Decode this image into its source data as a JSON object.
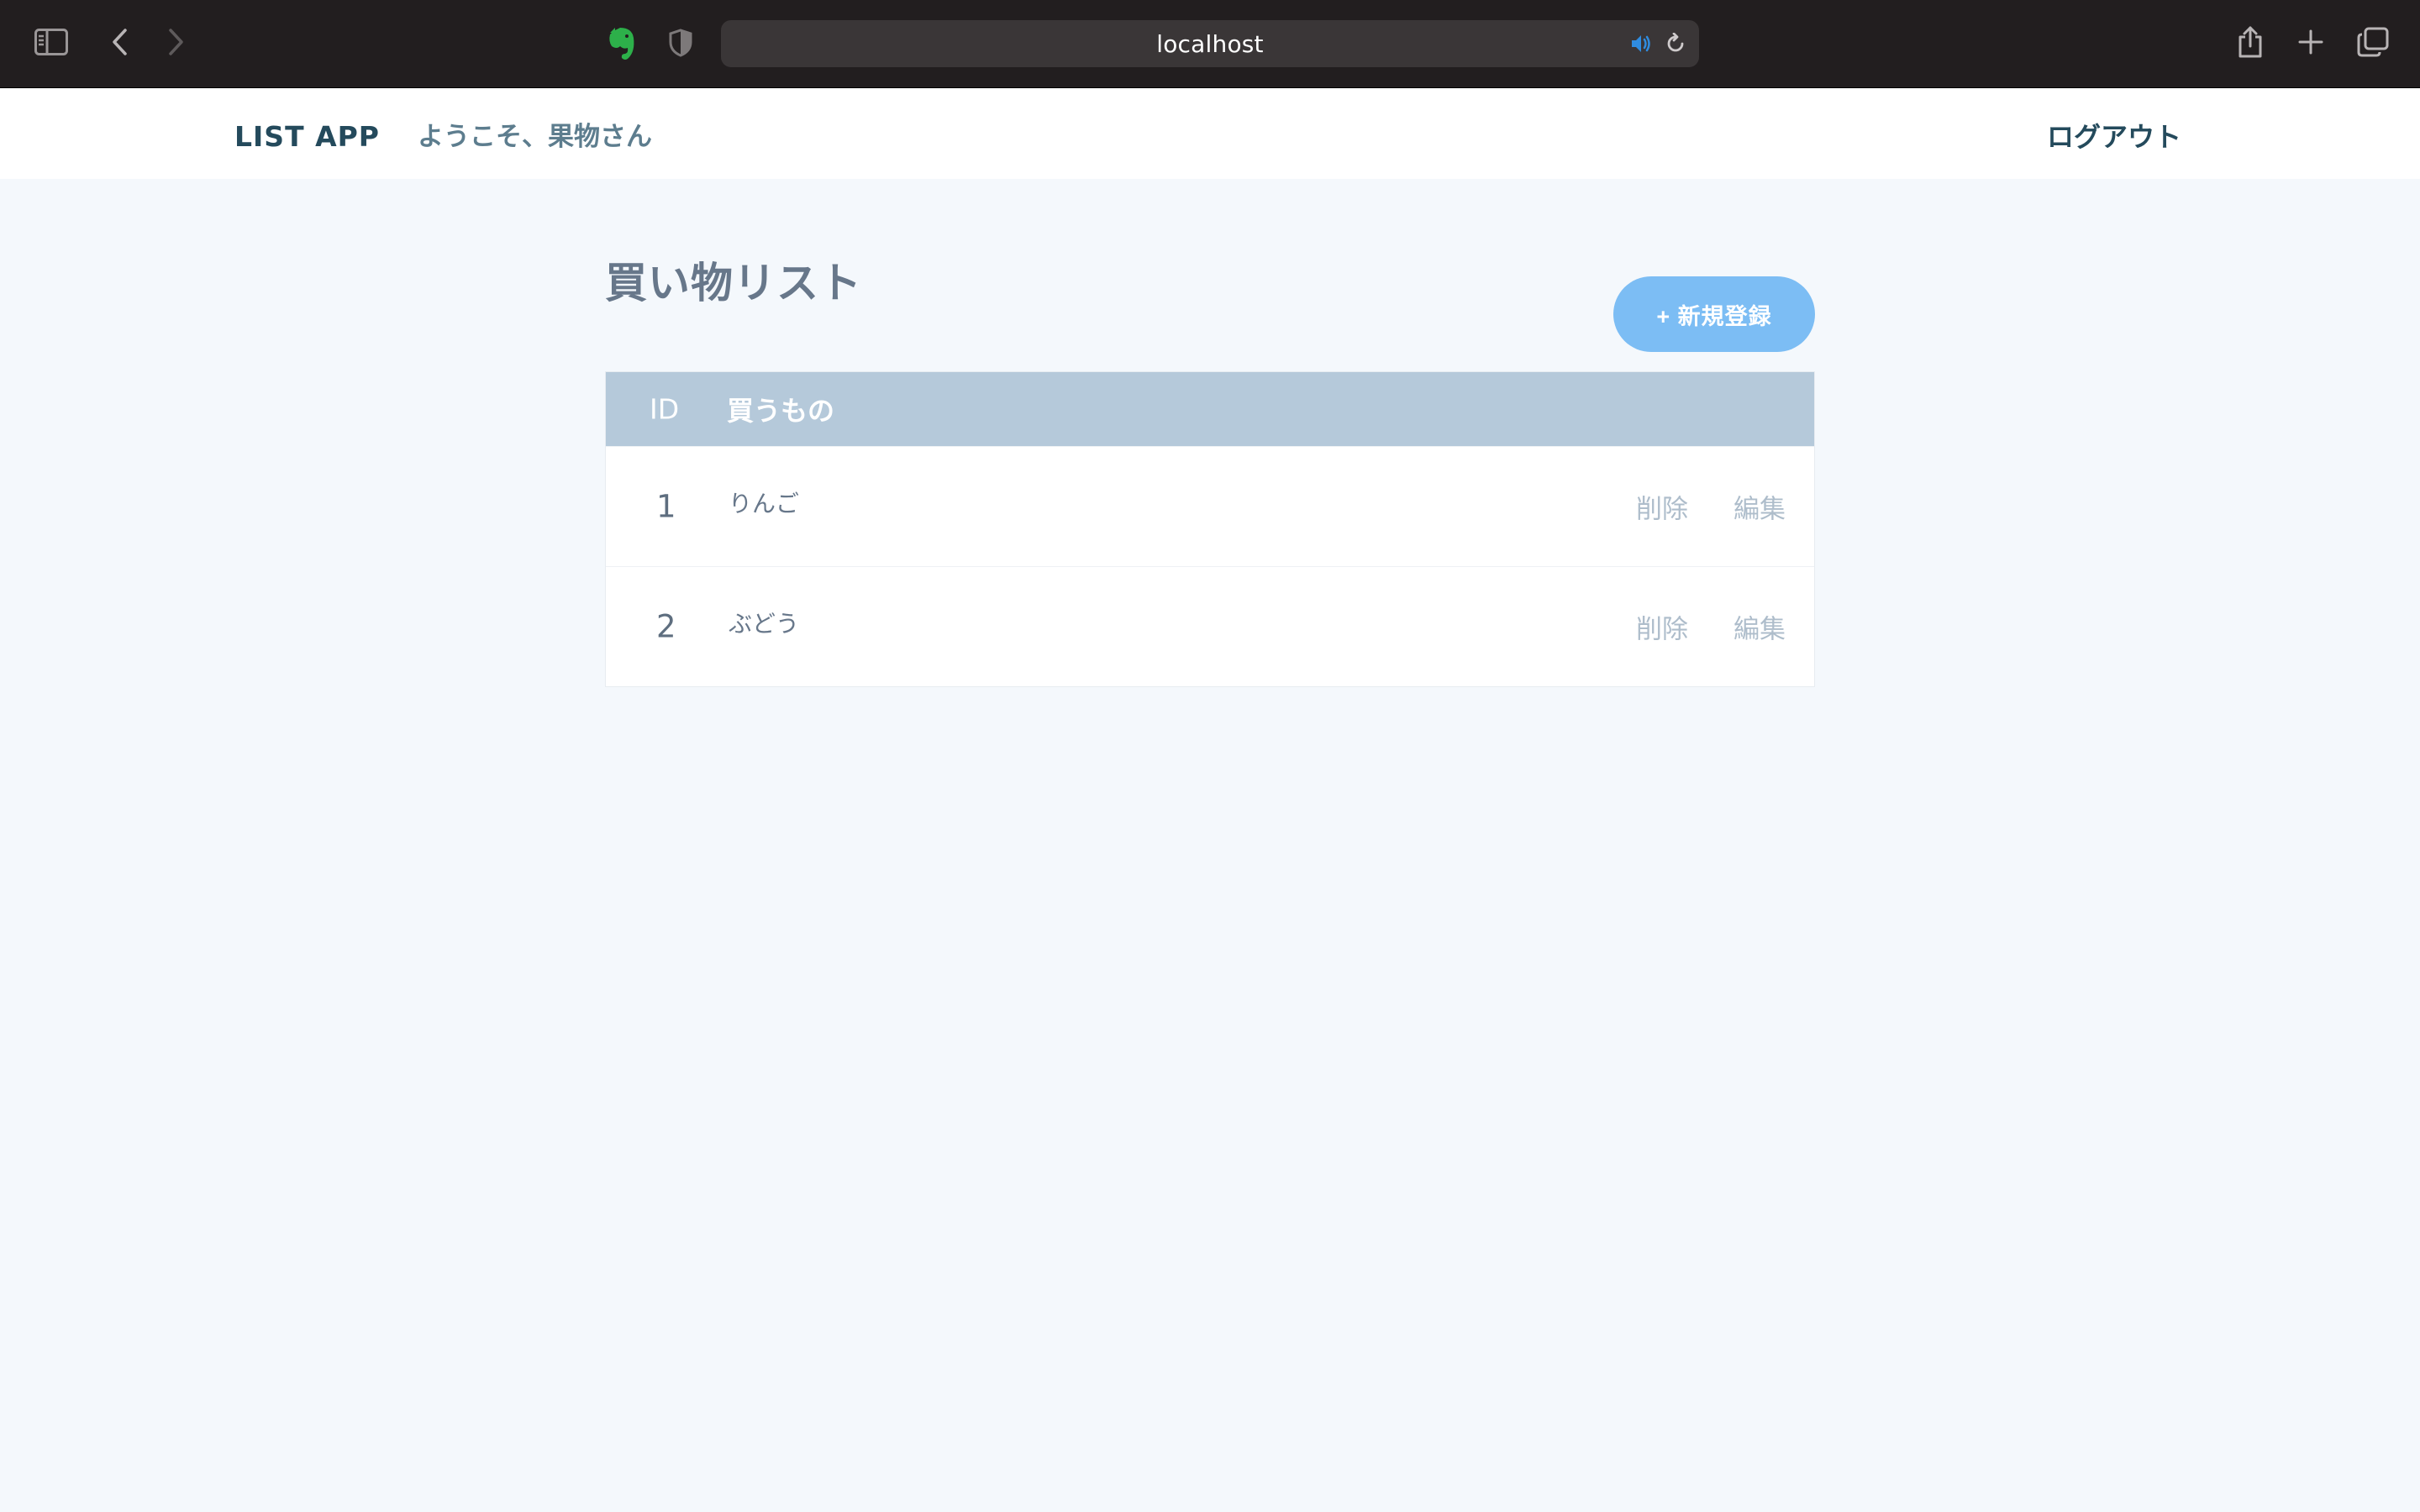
{
  "browser": {
    "url": "localhost",
    "icons": {
      "sidebar": "sidebar-icon",
      "back": "chevron-left-icon",
      "forward": "chevron-right-icon",
      "extension": "evernote-elephant-icon",
      "privacy": "shield-icon",
      "audio": "speaker-icon",
      "reload": "reload-icon",
      "share": "share-icon",
      "new_tab": "plus-icon",
      "tab_overview": "tabs-icon"
    },
    "accent_color": "#2f8ce0",
    "extension_color": "#2db04a"
  },
  "header": {
    "brand": "LIST APP",
    "welcome": "ようこそ、果物さん",
    "logout": "ログアウト"
  },
  "page": {
    "title": "買い物リスト",
    "new_button": "+ 新規登録"
  },
  "table": {
    "columns": [
      "ID",
      "買うもの"
    ],
    "rows": [
      {
        "id": "1",
        "item": "りんご",
        "delete": "削除",
        "edit": "編集"
      },
      {
        "id": "2",
        "item": "ぶどう",
        "delete": "削除",
        "edit": "編集"
      }
    ]
  },
  "colors": {
    "page_background": "#f4f8fc",
    "table_header": "#b5c9da",
    "button": "#7cbdf4",
    "brand_text": "#244a5c"
  }
}
